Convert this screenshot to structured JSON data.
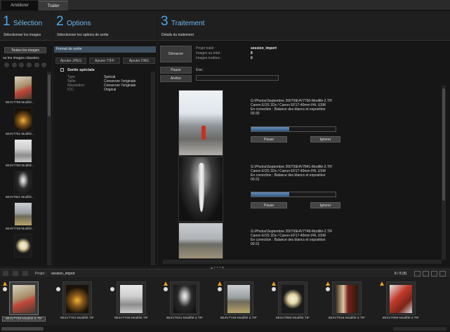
{
  "tabs": [
    {
      "label": "Améliorer",
      "active": false
    },
    {
      "label": "Traiter",
      "active": true
    }
  ],
  "col1": {
    "number": "1",
    "title": "Sélection",
    "subtitle": "Sélectionner les images",
    "all_images_button": "Toutes les images",
    "or_label": "ou les images classées",
    "thumbs": [
      {
        "label": "6E4V7759-Modifié..."
      },
      {
        "label": "6E4V7761-Modifié..."
      },
      {
        "label": "6E4V7760-Modifié..."
      },
      {
        "label": "6E4V7841-Modifié..."
      },
      {
        "label": "6E4V7748-Modifié..."
      }
    ]
  },
  "col2": {
    "number": "2",
    "title": "Options",
    "subtitle": "Sélectionner les options de sortie",
    "format_header": "Format de sortie",
    "add_buttons": [
      "Ajouter JPEG",
      "Ajouter TIFF",
      "Ajouter DNG"
    ],
    "special_title": "Sortie spéciale",
    "special_fields": [
      {
        "key": "Type :",
        "value": "Spécial"
      },
      {
        "key": "Taille:",
        "value": "Conserver l'originale"
      },
      {
        "key": "Résolution:",
        "value": "Conserver l'originale"
      },
      {
        "key": "ICC:",
        "value": "Original"
      }
    ]
  },
  "col3": {
    "number": "3",
    "title": "Traitement",
    "subtitle": "Détails du traitement",
    "start_button": "Démarrer",
    "pause_button": "Pause",
    "stop_button": "Arrêter",
    "project_label": "Projet traité :",
    "project_value": "session_import",
    "total_label": "Images au total :",
    "total_value": "8",
    "processed_label": "Images traitées :",
    "processed_value": "0",
    "status_label": "État :",
    "items": [
      {
        "path": "G:\\Photos\\Septembre 2007\\6E4V7760-Modifié-2.TIF",
        "camera": "Canon EOS 1Ds / Canon EF17-40mm f/4L USM",
        "correction": "En correction : Balance des blancs et exposition",
        "time": "00:30",
        "progress": 0.45,
        "pause": "Pause",
        "ignore": "Ignorer"
      },
      {
        "path": "G:\\Photos\\Septembre 2007\\6E4V7841-Modifié-2.TIF",
        "camera": "Canon EOS 1Ds / Canon EF17-40mm f/4L USM",
        "correction": "En correction : Balance des blancs et exposition",
        "time": "00:31",
        "progress": 0.45,
        "pause": "Pause",
        "ignore": "Ignorer"
      },
      {
        "path": "G:\\Photos\\Septembre 2007\\6E4V7748-Modifié-2.TIF",
        "camera": "Canon EOS 1Ds / Canon EF17-40mm f/4L USM",
        "correction": "En correction : Balance des blancs et exposition",
        "time": "00:31"
      }
    ]
  },
  "filmstrip": {
    "project_label": "Projet :",
    "project_value": "session_import",
    "count": "8 / 8 (8)",
    "items": [
      {
        "name": "6E4V7759-Modifié-2.TIF",
        "selected": true
      },
      {
        "name": "6E4V7761-Modifié.TIF"
      },
      {
        "name": "6E4V7760-Modifié.TIF"
      },
      {
        "name": "6E4V7841-Modifié-2.TIF"
      },
      {
        "name": "6E4V7748-Modifié-2.TIF"
      },
      {
        "name": "6E4V7880-Modifié.TIF"
      },
      {
        "name": "6E4V7916-Modifié-2.TIF"
      },
      {
        "name": "6E4V7900-Modifié-2.TIF"
      }
    ]
  },
  "colors": {
    "accent": "#4ea7e9",
    "progress": "#4a76a6",
    "warn": "#e8a020"
  }
}
